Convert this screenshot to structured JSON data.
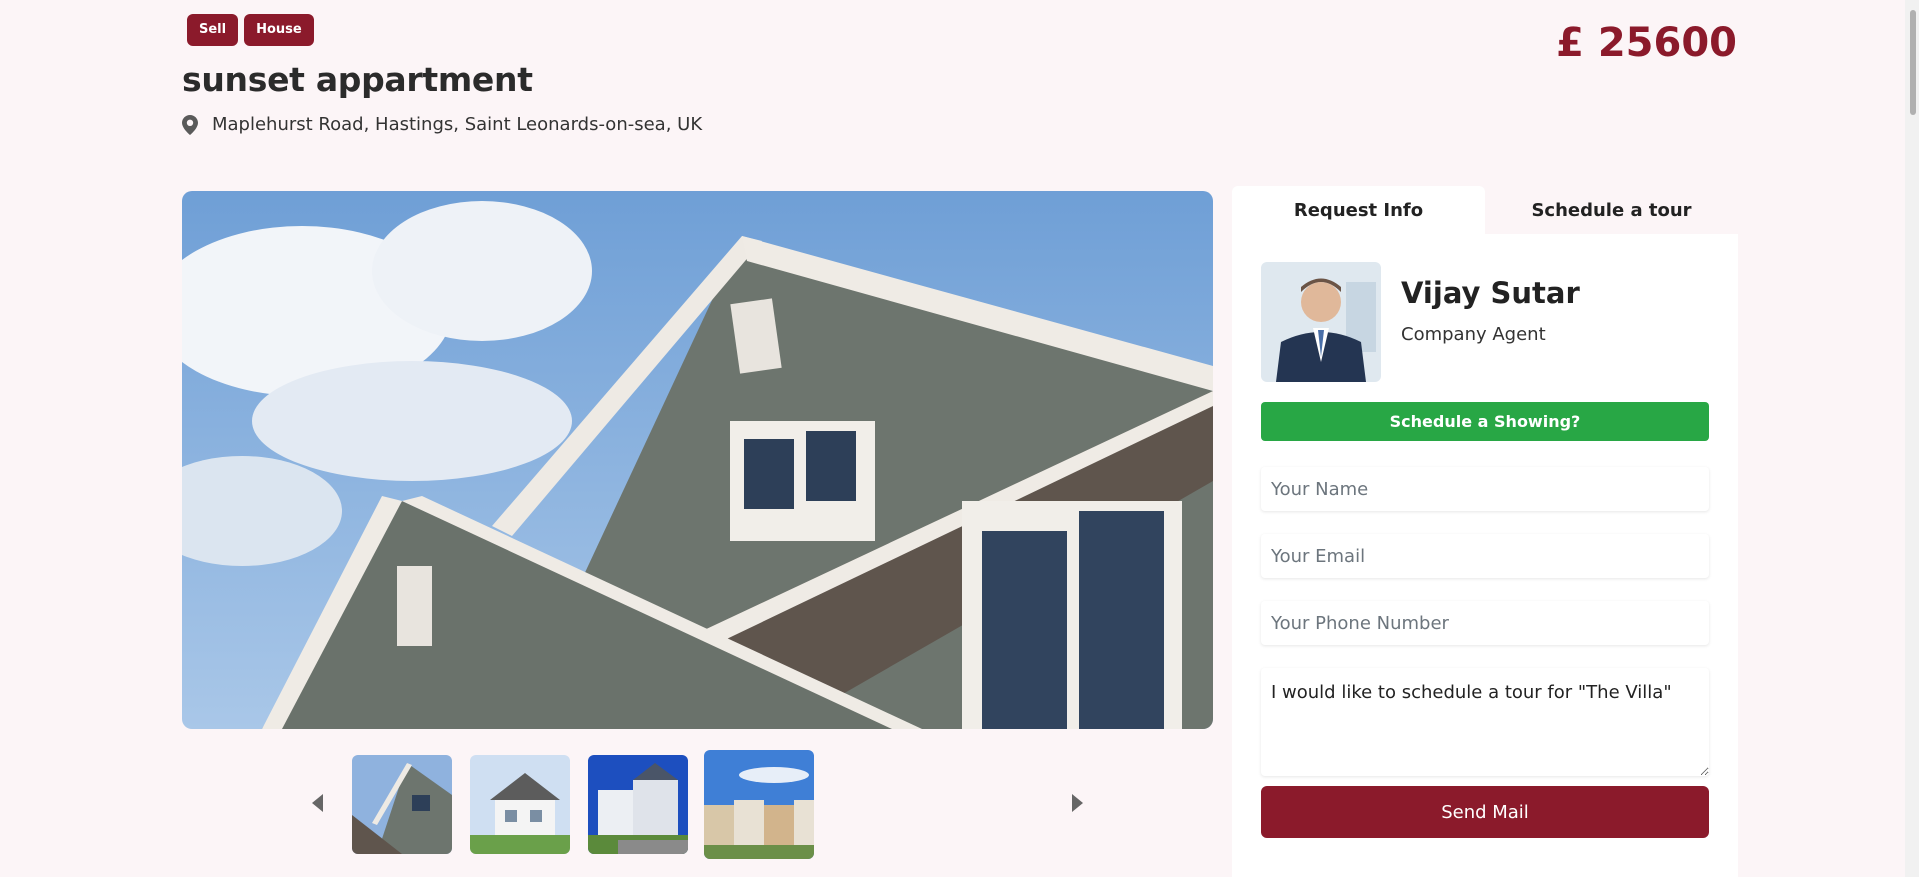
{
  "listing": {
    "badges": [
      "Sell",
      "House"
    ],
    "title": "sunset appartment",
    "address": "Maplehurst Road, Hastings, Saint Leonards-on-sea, UK",
    "price": "£ 25600"
  },
  "gallery": {
    "thumbnails": [
      "house-gable",
      "white-house",
      "blue-sky-houses",
      "row-houses"
    ],
    "active_thumbnail": 3
  },
  "panel": {
    "tabs": [
      "Request Info",
      "Schedule a tour"
    ],
    "active_tab": 0,
    "agent": {
      "name": "Vijay Sutar",
      "role": "Company Agent"
    },
    "showing_button": "Schedule a Showing?",
    "fields": {
      "name_placeholder": "Your Name",
      "email_placeholder": "Your Email",
      "phone_placeholder": "Your Phone Number",
      "message_value": "I would like to schedule a tour for \"The Villa\""
    },
    "send_button": "Send Mail"
  },
  "colors": {
    "brand": "#8b1a2b",
    "success": "#28a745",
    "background": "#fcf5f7"
  }
}
